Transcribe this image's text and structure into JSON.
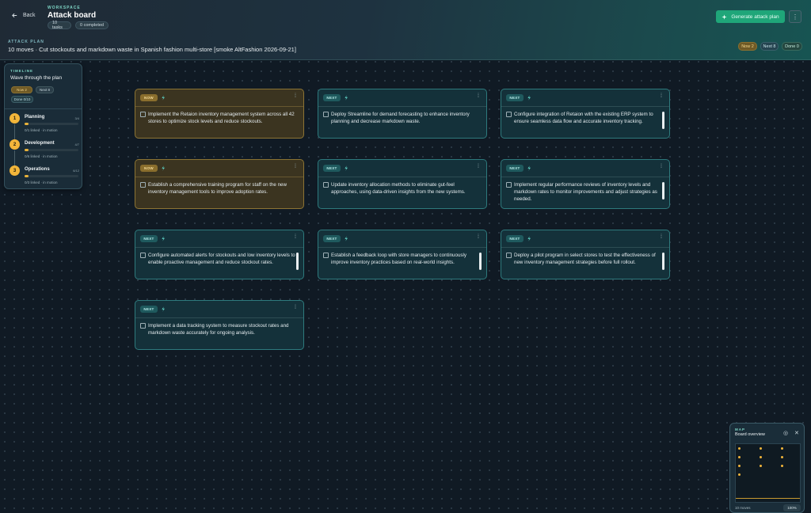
{
  "header": {
    "back_label": "Back",
    "workspace_label": "WORKSPACE",
    "title": "Attack board",
    "tasks_chip": "10 tasks",
    "completed_chip": "0 completed",
    "generate_label": "Generate attack plan",
    "more_label": "⋮"
  },
  "plan": {
    "label": "ATTACK PLAN",
    "title": "10 moves · Cut stockouts and markdown waste in Spanish fashion multi-store [smoke AltFashion 2026-09-21]",
    "now_chip": "Now 2",
    "next_chip": "Next 8",
    "done_chip": "Done 0"
  },
  "timeline": {
    "label": "TIMELINE",
    "title": "Wave through the plan",
    "now_chip": "Now 2",
    "next_chip": "Next 8",
    "done_chip": "Done 0/10",
    "phases": [
      {
        "num": "1",
        "name": "Planning",
        "date": "3/4",
        "meta": "0/1 linked · in motion",
        "progress": 0.08
      },
      {
        "num": "2",
        "name": "Development",
        "date": "4/7",
        "meta": "0/6 linked · in motion",
        "progress": 0.08
      },
      {
        "num": "3",
        "name": "Operations",
        "date": "6/12",
        "meta": "0/3 linked · in motion",
        "progress": 0.08
      }
    ]
  },
  "cards": [
    {
      "status": "NOW",
      "text": "Implement the Retaion inventory management system across all 42 stores to optimize stock levels and reduce stockouts."
    },
    {
      "status": "NEXT",
      "text": "Deploy Streamline for demand forecasting to enhance inventory planning and decrease markdown waste."
    },
    {
      "status": "NEXT",
      "text": "Configure integration of Retaion with the existing ERP system to ensure seamless data flow and accurate inventory tracking."
    },
    {
      "status": "NOW",
      "text": "Establish a comprehensive training program for staff on the new inventory management tools to improve adoption rates."
    },
    {
      "status": "NEXT",
      "text": "Update inventory allocation methods to eliminate gut-feel approaches, using data-driven insights from the new systems."
    },
    {
      "status": "NEXT",
      "text": "Implement regular performance reviews of inventory levels and markdown rates to monitor improvements and adjust strategies as needed."
    },
    {
      "status": "NEXT",
      "text": "Configure automated alerts for stockouts and low inventory levels to enable proactive management and reduce stockout rates."
    },
    {
      "status": "NEXT",
      "text": "Establish a feedback loop with store managers to continuously improve inventory practices based on real-world insights."
    },
    {
      "status": "NEXT",
      "text": "Deploy a pilot program in select stores to test the effectiveness of new inventory management strategies before full rollout."
    },
    {
      "status": "NEXT",
      "text": "Implement a data tracking system to measure stockout rates and markdown waste accurately for ongoing analysis."
    }
  ],
  "minimap": {
    "label": "MAP",
    "title": "Board overview",
    "footer": "10 moves",
    "zoom": "100%"
  },
  "icons": {
    "back": "arrow-left-icon",
    "generate": "sparkle-icon",
    "card_spark": "sparkle-icon",
    "card_menu": "drag-dots-icon",
    "minimap_fit": "target-icon",
    "minimap_close": "close-icon"
  },
  "colors": {
    "accent_green": "#1fa679",
    "now_amber": "#8c7434",
    "next_teal": "#2e7a7d",
    "phase_yellow": "#f2b53a"
  }
}
